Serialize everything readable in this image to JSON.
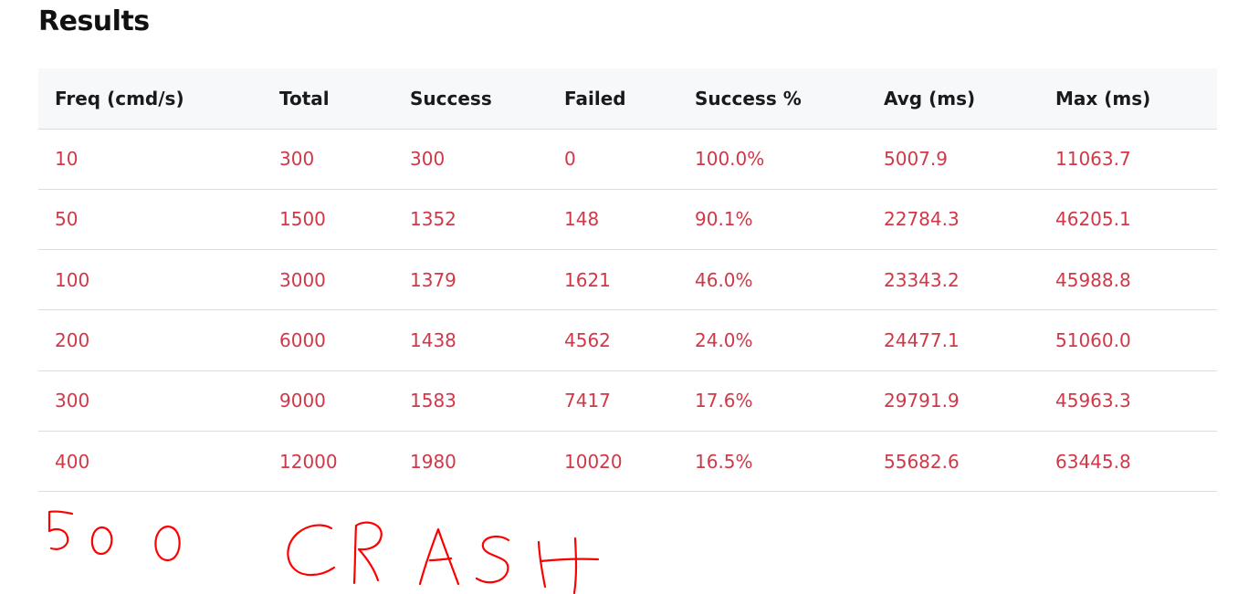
{
  "heading": "Results",
  "table": {
    "headers": [
      "Freq (cmd/s)",
      "Total",
      "Success",
      "Failed",
      "Success %",
      "Avg (ms)",
      "Max (ms)"
    ],
    "rows": [
      [
        "10",
        "300",
        "300",
        "0",
        "100.0%",
        "5007.9",
        "11063.7"
      ],
      [
        "50",
        "1500",
        "1352",
        "148",
        "90.1%",
        "22784.3",
        "46205.1"
      ],
      [
        "100",
        "3000",
        "1379",
        "1621",
        "46.0%",
        "23343.2",
        "45988.8"
      ],
      [
        "200",
        "6000",
        "1438",
        "4562",
        "24.0%",
        "24477.1",
        "51060.0"
      ],
      [
        "300",
        "9000",
        "1583",
        "7417",
        "17.6%",
        "29791.9",
        "45963.3"
      ],
      [
        "400",
        "12000",
        "1980",
        "10020",
        "16.5%",
        "55682.6",
        "63445.8"
      ]
    ]
  },
  "annotation": {
    "freq": "500",
    "note": "CRASH",
    "color": "#ff0000"
  },
  "colors": {
    "cell_text": "#d03848",
    "header_bg": "#f7f8f9",
    "row_border": "#dcdcdc"
  }
}
